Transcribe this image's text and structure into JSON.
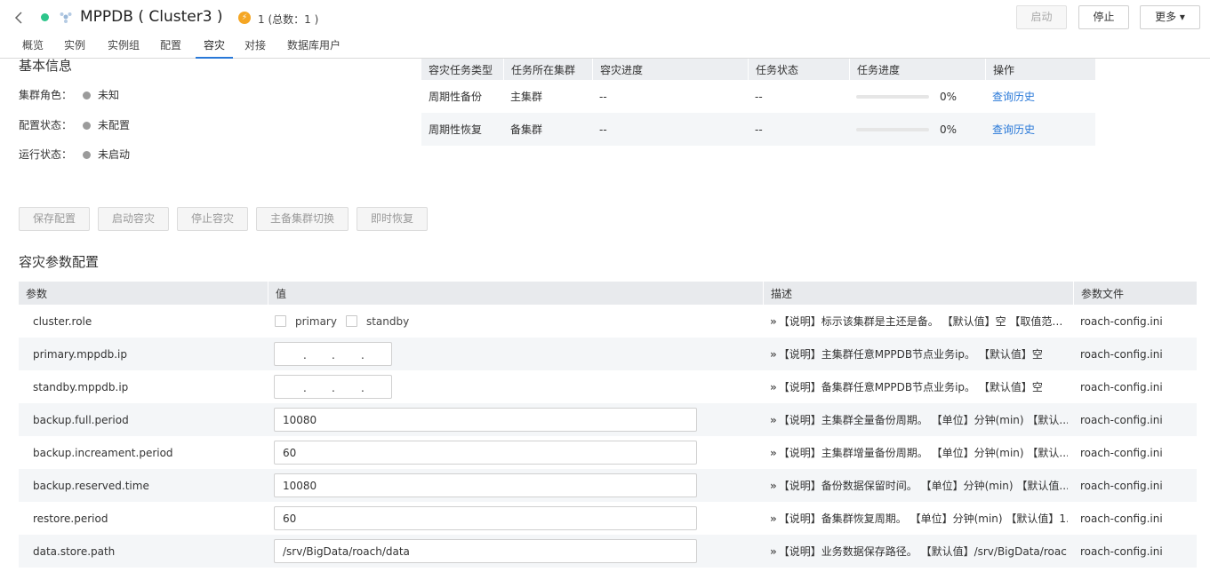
{
  "header": {
    "title": "MPPDB ( Cluster3 )",
    "alarm_count": "1 (总数：1 )",
    "start_label": "启动",
    "stop_label": "停止",
    "more_label": "更多 ▾"
  },
  "tabs": [
    {
      "label": "概览"
    },
    {
      "label": "实例"
    },
    {
      "label": "实例组"
    },
    {
      "label": "配置"
    },
    {
      "label": "容灾"
    },
    {
      "label": "对接"
    },
    {
      "label": "数据库用户"
    }
  ],
  "basic_info": {
    "title": "基本信息",
    "rows": [
      {
        "label": "集群角色：",
        "value": "未知"
      },
      {
        "label": "配置状态：",
        "value": "未配置"
      },
      {
        "label": "运行状态：",
        "value": "未启动"
      }
    ]
  },
  "task_table": {
    "headers": [
      "容灾任务类型",
      "任务所在集群",
      "容灾进度",
      "任务状态",
      "任务进度",
      "操作"
    ],
    "rows": [
      {
        "type": "周期性备份",
        "cluster": "主集群",
        "progress": "--",
        "status": "--",
        "percent": "0%",
        "action": "查询历史"
      },
      {
        "type": "周期性恢复",
        "cluster": "备集群",
        "progress": "--",
        "status": "--",
        "percent": "0%",
        "action": "查询历史"
      }
    ]
  },
  "actions": {
    "save": "保存配置",
    "start_dr": "启动容灾",
    "stop_dr": "停止容灾",
    "switch": "主备集群切换",
    "instant_restore": "即时恢复"
  },
  "params": {
    "title": "容灾参数配置",
    "headers": [
      "参数",
      "值",
      "描述",
      "参数文件"
    ],
    "role_options": [
      "primary",
      "standby"
    ],
    "ip_dots": ".",
    "rows": [
      {
        "name": "cluster.role",
        "value": "",
        "desc": "【说明】标示该集群是主还是备。 【默认值】空 【取值范围...",
        "file": "roach-config.ini"
      },
      {
        "name": "primary.mppdb.ip",
        "value": "",
        "desc": "【说明】主集群任意MPPDB节点业务ip。 【默认值】空",
        "file": "roach-config.ini"
      },
      {
        "name": "standby.mppdb.ip",
        "value": "",
        "desc": "【说明】备集群任意MPPDB节点业务ip。 【默认值】空",
        "file": "roach-config.ini"
      },
      {
        "name": "backup.full.period",
        "value": "10080",
        "desc": "【说明】主集群全量备份周期。 【单位】分钟(min) 【默认...",
        "file": "roach-config.ini"
      },
      {
        "name": "backup.increament.period",
        "value": "60",
        "desc": "【说明】主集群增量备份周期。 【单位】分钟(min) 【默认...",
        "file": "roach-config.ini"
      },
      {
        "name": "backup.reserved.time",
        "value": "10080",
        "desc": "【说明】备份数据保留时间。 【单位】分钟(min) 【默认值...",
        "file": "roach-config.ini"
      },
      {
        "name": "restore.period",
        "value": "60",
        "desc": "【说明】备集群恢复周期。 【单位】分钟(min) 【默认值】1...",
        "file": "roach-config.ini"
      },
      {
        "name": "data.store.path",
        "value": "/srv/BigData/roach/data",
        "desc": "【说明】业务数据保存路径。 【默认值】/srv/BigData/roac...",
        "file": "roach-config.ini"
      }
    ]
  }
}
